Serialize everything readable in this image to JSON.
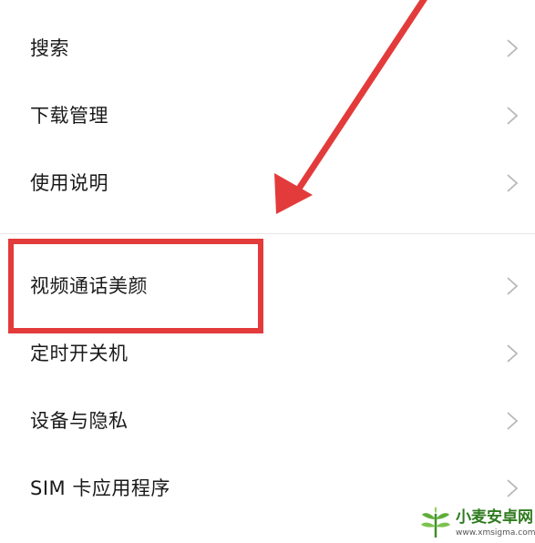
{
  "settings": {
    "items": [
      {
        "label": "搜索"
      },
      {
        "label": "下载管理"
      },
      {
        "label": "使用说明"
      },
      {
        "label": "视频通话美颜"
      },
      {
        "label": "定时开关机"
      },
      {
        "label": "设备与隐私"
      },
      {
        "label": "SIM 卡应用程序"
      }
    ]
  },
  "annotation": {
    "highlight_color": "#e33b3b",
    "highlighted_item": "视频通话美颜"
  },
  "icons": {
    "row_chevron": "chevron-right-icon",
    "arrow": "arrow-icon",
    "watermark_logo": "sprout-logo-icon"
  },
  "watermark": {
    "name": "小麦安卓网",
    "url": "www.xmsigma.com"
  }
}
